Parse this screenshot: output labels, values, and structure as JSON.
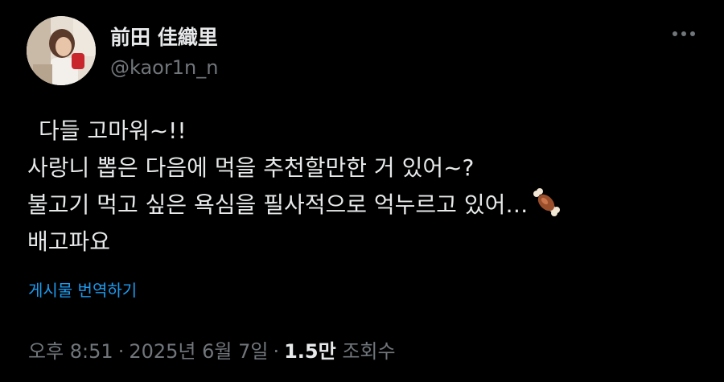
{
  "tweet": {
    "display_name": "前田 佳織里",
    "handle": "@kaor1n_n",
    "lines": [
      "다들 고마워~!!",
      "사랑니 뽑은 다음에 먹을 추천할만한 거 있어~?",
      "불고기 먹고 싶은 욕심을 필사적으로 억누르고 있어…",
      "배고파요"
    ],
    "emoji_icon": "meat-on-bone-icon",
    "translate_label": "게시물 번역하기",
    "time": "오후 8:51",
    "date": "2025년 6월 7일",
    "separator": "·",
    "views_count": "1.5만",
    "views_label": "조회수"
  },
  "colors": {
    "background": "#000000",
    "primary_text": "#e7e9ea",
    "secondary_text": "#71767b",
    "link": "#1d9bf0"
  }
}
